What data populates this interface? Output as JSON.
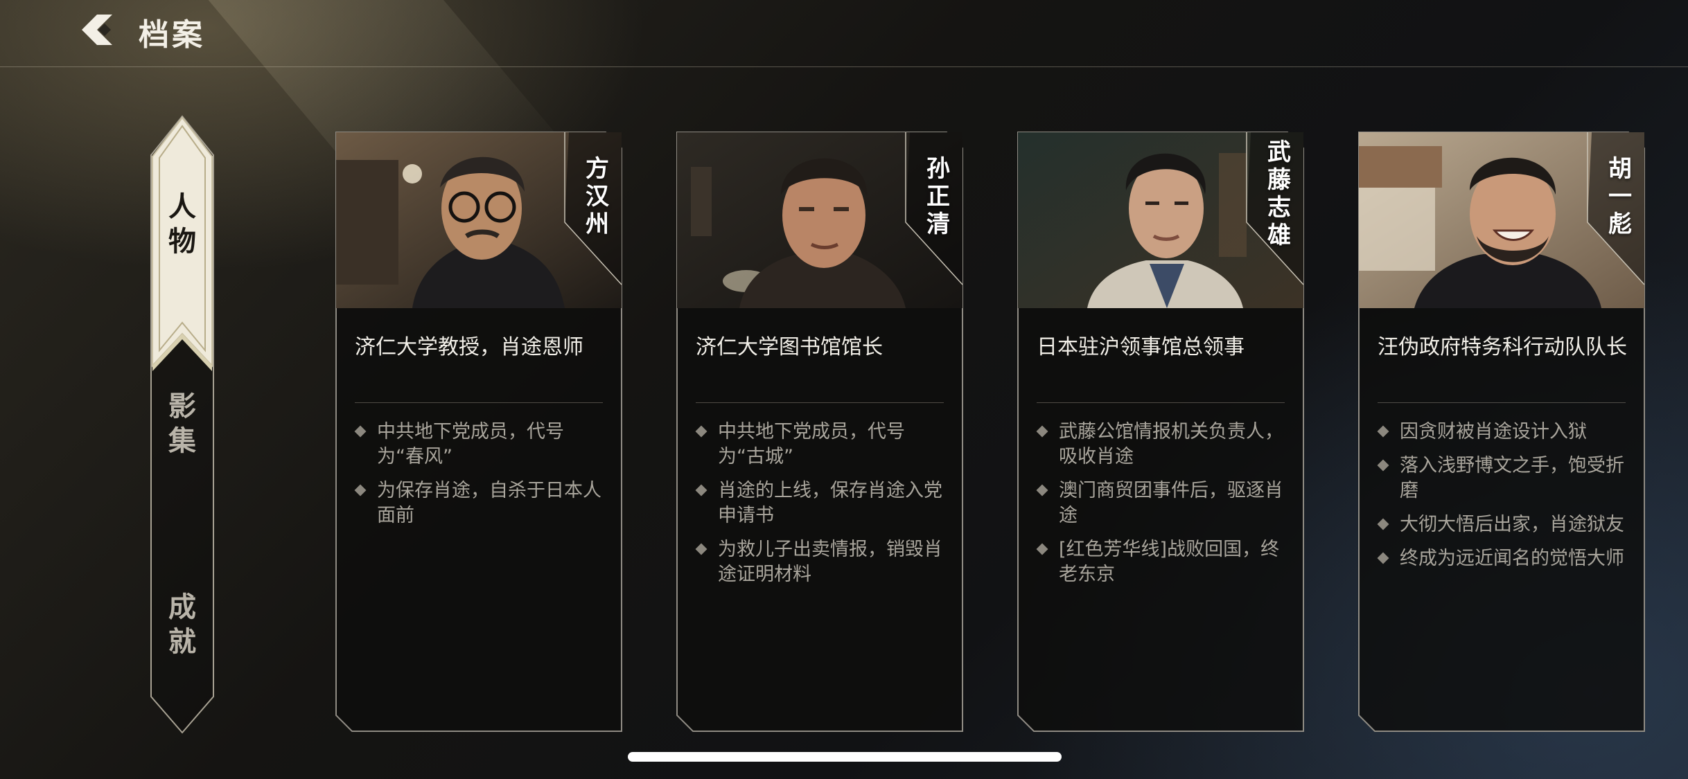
{
  "header": {
    "title": "档案",
    "back_icon": "back-chevron-icon"
  },
  "nav": {
    "items": [
      {
        "label": "人物",
        "chars": [
          "人",
          "物"
        ],
        "active": true
      },
      {
        "label": "影集",
        "chars": [
          "影",
          "集"
        ],
        "active": false
      },
      {
        "label": "成就",
        "chars": [
          "成",
          "就"
        ],
        "active": false
      }
    ]
  },
  "cards": [
    {
      "name": "方汉州",
      "name_chars": [
        "方",
        "汉",
        "州"
      ],
      "role": "济仁大学教授，肖途恩师",
      "facts": [
        "中共地下党成员，代号为“春风”",
        "为保存肖途，自杀于日本人面前"
      ]
    },
    {
      "name": "孙正清",
      "name_chars": [
        "孙",
        "正",
        "清"
      ],
      "role": "济仁大学图书馆馆长",
      "facts": [
        "中共地下党成员，代号为“古城”",
        "肖途的上线，保存肖途入党申请书",
        "为救儿子出卖情报，销毁肖途证明材料"
      ]
    },
    {
      "name": "武藤志雄",
      "name_chars": [
        "武",
        "藤",
        "志",
        "雄"
      ],
      "role": "日本驻沪领事馆总领事",
      "facts": [
        "武藤公馆情报机关负责人，吸收肖途",
        "澳门商贸团事件后，驱逐肖途",
        "[红色芳华线]战败回国，终老东京"
      ]
    },
    {
      "name": "胡一彪",
      "name_chars": [
        "胡",
        "一",
        "彪"
      ],
      "role": "汪伪政府特务科行动队队长",
      "facts": [
        "因贪财被肖途设计入狱",
        "落入浅野博文之手，饱受折磨",
        "大彻大悟后出家，肖途狱友",
        "终成为远近闻名的觉悟大师"
      ]
    }
  ],
  "colors": {
    "accent_gold": "#d8d0b0",
    "card_border": "#8f8b83",
    "text_muted": "#a9a59c"
  }
}
